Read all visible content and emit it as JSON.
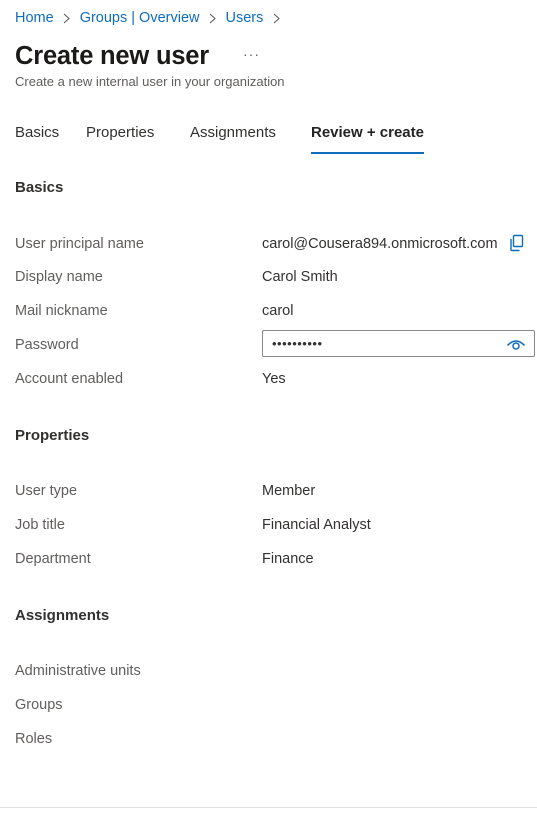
{
  "breadcrumb": [
    {
      "label": "Home"
    },
    {
      "label": "Groups | Overview"
    },
    {
      "label": "Users"
    }
  ],
  "header": {
    "title": "Create new user",
    "more": "···",
    "subtitle": "Create a new internal user in your organization"
  },
  "tabs": [
    {
      "label": "Basics",
      "active": false
    },
    {
      "label": "Properties",
      "active": false
    },
    {
      "label": "Assignments",
      "active": false
    },
    {
      "label": "Review + create",
      "active": true
    }
  ],
  "basics": {
    "title": "Basics",
    "upn_label": "User principal name",
    "upn_value": "carol@Cousera894.onmicrosoft.com",
    "display_name_label": "Display name",
    "display_name_value": "Carol Smith",
    "mail_nickname_label": "Mail nickname",
    "mail_nickname_value": "carol",
    "password_label": "Password",
    "password_value": "••••••••••",
    "account_enabled_label": "Account enabled",
    "account_enabled_value": "Yes"
  },
  "properties": {
    "title": "Properties",
    "user_type_label": "User type",
    "user_type_value": "Member",
    "job_title_label": "Job title",
    "job_title_value": "Financial Analyst",
    "department_label": "Department",
    "department_value": "Finance"
  },
  "assignments": {
    "title": "Assignments",
    "admin_units_label": "Administrative units",
    "groups_label": "Groups",
    "roles_label": "Roles"
  },
  "icons": {
    "copy": "copy-icon",
    "reveal_password": "eye-icon",
    "breadcrumb_separator": "chevron-right-icon"
  },
  "colors": {
    "accent": "#0f6cbd",
    "label": "#605e5c",
    "text": "#323130"
  }
}
